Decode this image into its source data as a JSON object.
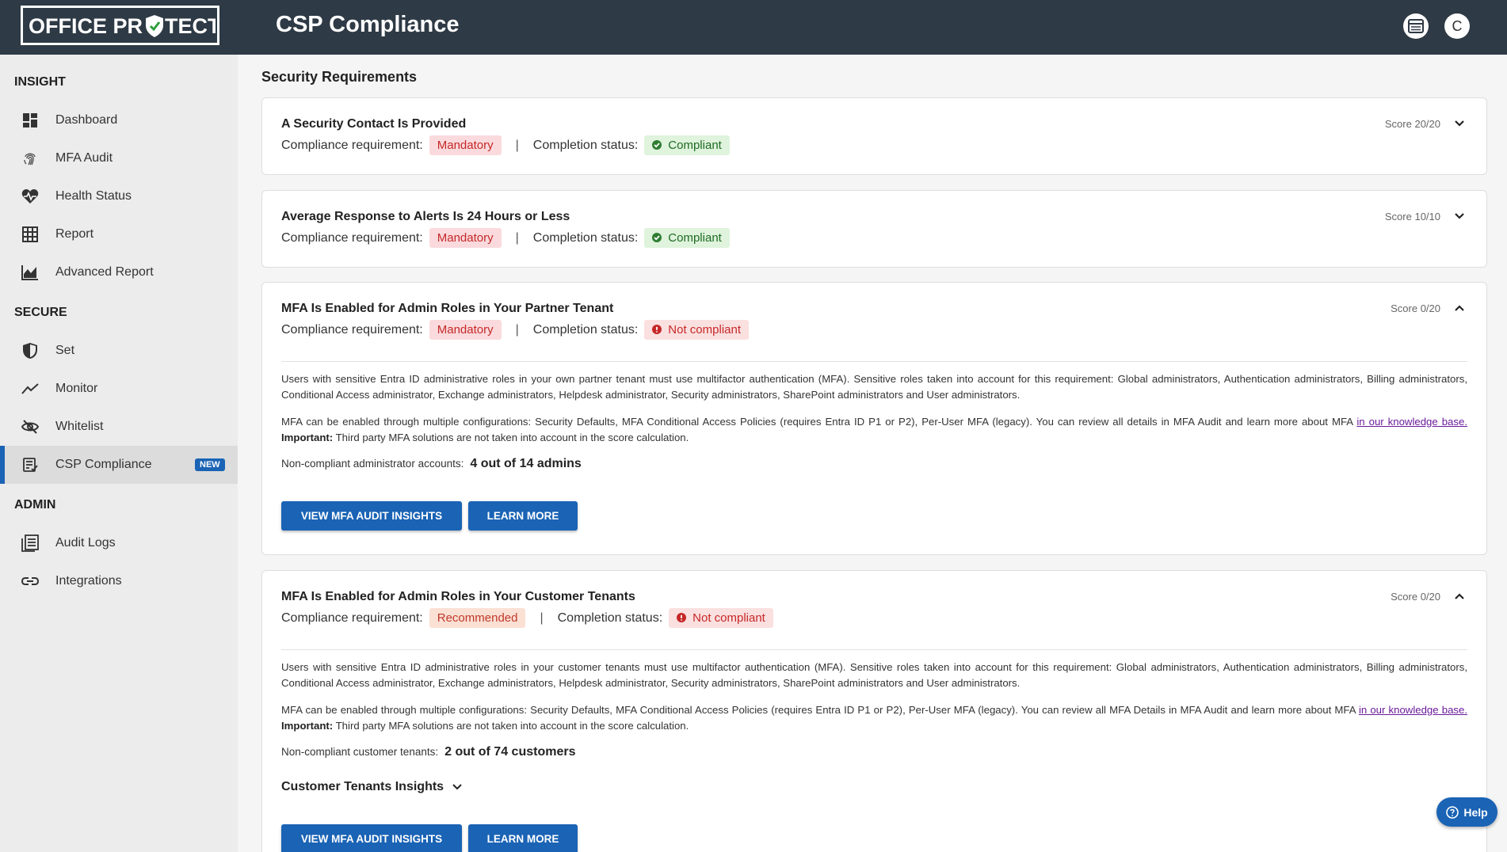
{
  "header": {
    "logo_text": "OFFICE PROTECT",
    "title": "CSP Compliance",
    "avatar_letter": "C"
  },
  "sidebar": {
    "sections": [
      {
        "label": "INSIGHT"
      },
      {
        "label": "SECURE"
      },
      {
        "label": "ADMIN"
      }
    ],
    "items": [
      {
        "label": "Dashboard",
        "icon": "dashboard-icon"
      },
      {
        "label": "MFA Audit",
        "icon": "fingerprint-icon"
      },
      {
        "label": "Health Status",
        "icon": "heart-pulse-icon"
      },
      {
        "label": "Report",
        "icon": "grid-icon"
      },
      {
        "label": "Advanced Report",
        "icon": "chart-icon"
      },
      {
        "label": "Set",
        "icon": "shield-icon"
      },
      {
        "label": "Monitor",
        "icon": "trend-icon"
      },
      {
        "label": "Whitelist",
        "icon": "eye-off-icon"
      },
      {
        "label": "CSP Compliance",
        "icon": "doc-check-icon",
        "badge": "NEW",
        "active": true
      },
      {
        "label": "Audit Logs",
        "icon": "list-doc-icon"
      },
      {
        "label": "Integrations",
        "icon": "link-icon"
      }
    ]
  },
  "main": {
    "section_title": "Security Requirements",
    "labels": {
      "compliance_requirement": "Compliance requirement:",
      "completion_status": "Completion status:",
      "separator": "|"
    },
    "cards": [
      {
        "title": "A Security Contact Is Provided",
        "score": "Score 20/20",
        "requirement": "Mandatory",
        "status": "Compliant"
      },
      {
        "title": "Average Response to Alerts Is 24 Hours or Less",
        "score": "Score 10/10",
        "requirement": "Mandatory",
        "status": "Compliant"
      },
      {
        "title": "MFA Is Enabled for Admin Roles in Your Partner Tenant",
        "score": "Score 0/20",
        "requirement": "Mandatory",
        "status": "Not compliant",
        "desc1": "Users with sensitive Entra ID administrative roles in your own partner tenant must use multifactor authentication (MFA). Sensitive roles taken into account for this requirement: Global administrators, Authentication administrators, Billing administrators, Conditional Access administrator, Exchange administrators, Helpdesk administrator, Security administrators, SharePoint administrators and User administrators.",
        "desc2_pre": "MFA can be enabled through multiple configurations: Security Defaults, MFA Conditional Access Policies (requires Entra ID P1 or P2), Per-User MFA (legacy). You can review all details in MFA Audit and learn more about MFA ",
        "desc2_link": "in our knowledge base.",
        "desc2_important": "Important:",
        "desc2_post": " Third party MFA solutions are not taken into account in the score calculation.",
        "noncomp_label": "Non-compliant administrator accounts:",
        "noncomp_value": "4 out of 14 admins",
        "btn_primary": "VIEW MFA AUDIT INSIGHTS",
        "btn_secondary": "LEARN MORE"
      },
      {
        "title": "MFA Is Enabled for Admin Roles in Your Customer Tenants",
        "score": "Score 0/20",
        "requirement": "Recommended",
        "status": "Not compliant",
        "desc1": "Users with sensitive Entra ID administrative roles in your customer tenants must use multifactor authentication (MFA). Sensitive roles taken into account for this requirement: Global administrators, Authentication administrators, Billing administrators, Conditional Access administrator, Exchange administrators, Helpdesk administrator, Security administrators, SharePoint administrators and User administrators.",
        "desc2_pre": "MFA can be enabled through multiple configurations: Security Defaults, MFA Conditional Access Policies (requires Entra ID P1 or P2), Per-User MFA (legacy). You can review all MFA Details in MFA Audit and learn more about MFA ",
        "desc2_link": "in our knowledge base.",
        "desc2_important": "Important:",
        "desc2_post": " Third party MFA solutions are not taken into account in the score calculation.",
        "noncomp_label": "Non-compliant customer tenants:",
        "noncomp_value": "2 out of 74 customers",
        "insights_label": "Customer Tenants Insights",
        "btn_primary": "VIEW MFA AUDIT INSIGHTS",
        "btn_secondary": "LEARN MORE"
      }
    ]
  },
  "help": {
    "label": "Help"
  },
  "colors": {
    "topbar": "#2e3a45",
    "accent": "#1a63b5",
    "compliant": "#2e7d32",
    "not_compliant": "#c62828"
  }
}
